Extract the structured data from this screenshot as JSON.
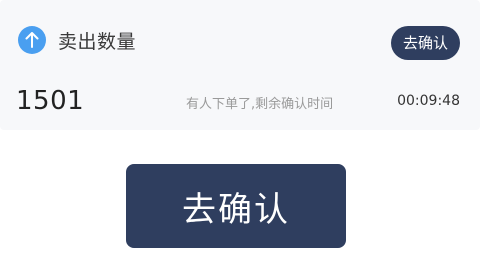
{
  "order": {
    "icon": "up-arrow-icon",
    "title": "卖出数量",
    "confirm_label": "去确认",
    "quantity": "1501",
    "notice": "有人下单了,剩余确认时间",
    "timer": "00:09:48"
  },
  "primary_button": {
    "label": "去确认"
  },
  "colors": {
    "accent_blue": "#4a9ff0",
    "button_navy": "#2f3e5f",
    "card_bg": "#f7f8fa"
  }
}
